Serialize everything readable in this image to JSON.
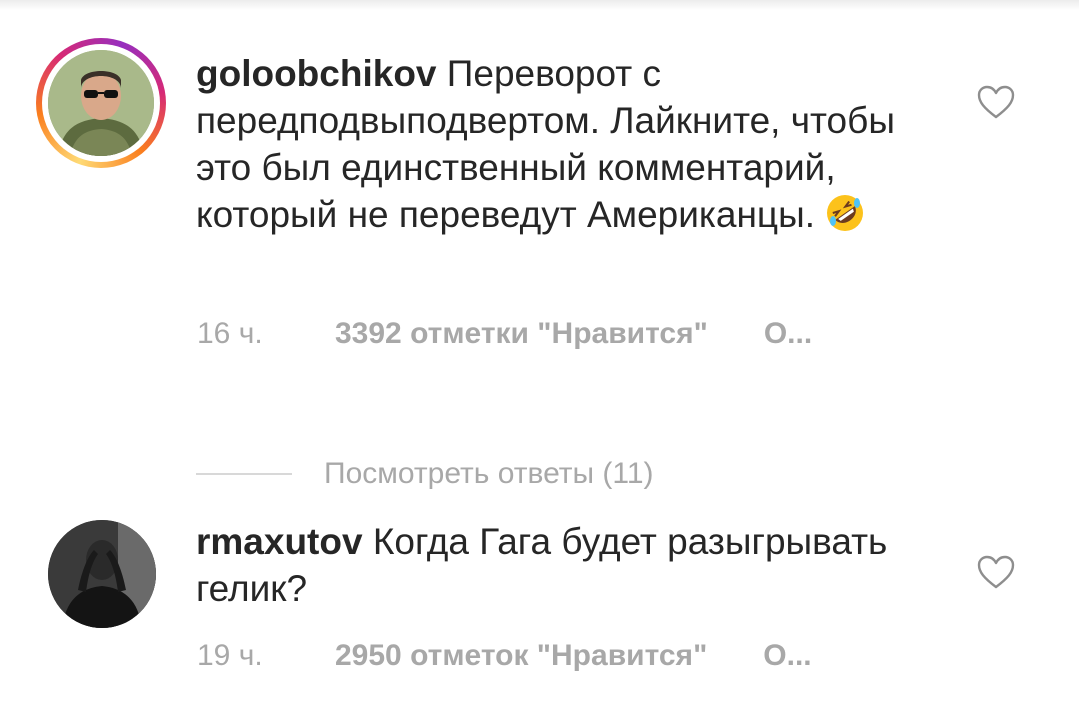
{
  "comments": [
    {
      "username": "goloobchikov",
      "text": "Переворот с передподвыподвертом. Лайкните, чтобы это был единственный комментарий, который не переведут Американцы.",
      "emoji": "rolling-on-floor-laughing-emoji",
      "time": "16 ч.",
      "likes": "3392 отметки \"Нравится\"",
      "reply": "О...",
      "view_replies": "Посмотреть ответы (11)",
      "avatar_ring": true
    },
    {
      "username": "rmaxutov",
      "text": "Когда Гага будет разыгрывать гелик?",
      "time": "19 ч.",
      "likes": "2950 отметок \"Нравится\"",
      "reply": "О..."
    }
  ],
  "icons": {
    "like": "heart-outline-icon"
  },
  "colors": {
    "text": "#262626",
    "secondary": "#a8a8a8",
    "story_ring": [
      "#feda75",
      "#fa7e1e",
      "#d62976",
      "#962fbf"
    ]
  }
}
